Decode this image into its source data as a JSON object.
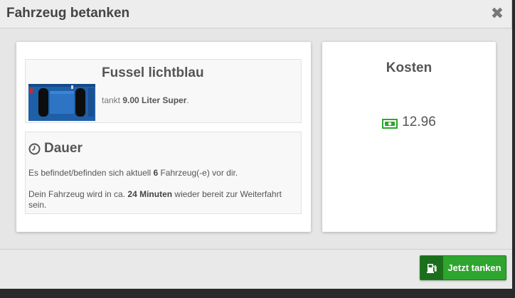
{
  "modal": {
    "title": "Fahrzeug betanken",
    "close_symbol": "✖"
  },
  "vehicle": {
    "name": "Fussel lichtblau",
    "refuel_prefix": "tankt ",
    "amount": "9.00 Liter Super",
    "refuel_suffix": ".",
    "image_icon": "car-top-view-icon",
    "car_color": "#1f5fa8"
  },
  "duration": {
    "title": "Dauer",
    "icon": "clock-icon",
    "queue_prefix": "Es befindet/befinden sich aktuell ",
    "queue_count": "6",
    "queue_suffix": " Fahrzeug(-e) vor dir.",
    "ready_prefix": "Dein Fahrzeug wird in ca. ",
    "ready_time": "24 Minuten",
    "ready_suffix": " wieder bereit zur Weiterfahrt sein."
  },
  "costs": {
    "title": "Kosten",
    "icon": "money-icon",
    "value": "12.96",
    "icon_color": "#2ea52e"
  },
  "footer": {
    "button_label": "Jetzt tanken",
    "button_icon": "fuel-pump-icon",
    "button_color": "#2ea52e"
  }
}
